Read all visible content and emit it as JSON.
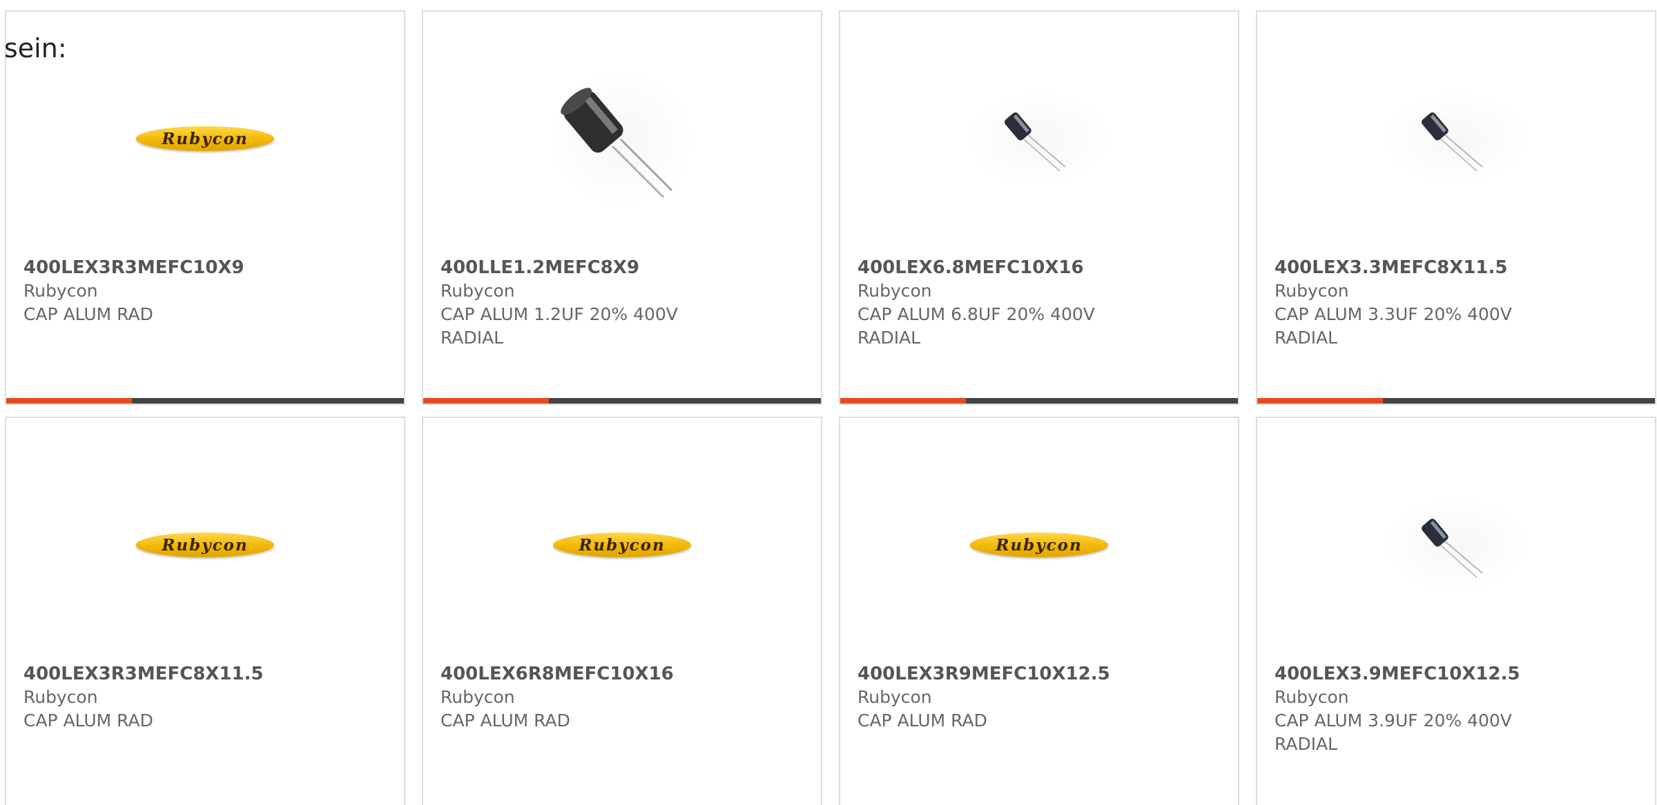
{
  "intro_text": "sein:",
  "colors": {
    "accent_bar": "#e84a1e",
    "bar": "#444444",
    "logo_yellow": "#f2b705"
  },
  "products": [
    {
      "part": "400LEX3R3MEFC10X9",
      "manufacturer": "Rubycon",
      "desc1": "CAP ALUM RAD",
      "desc2": "",
      "image": "rubycon-logo"
    },
    {
      "part": "400LLE1.2MEFC8X9",
      "manufacturer": "Rubycon",
      "desc1": "CAP ALUM 1.2UF 20% 400V",
      "desc2": "RADIAL",
      "image": "capacitor-photo-large"
    },
    {
      "part": "400LEX6.8MEFC10X16",
      "manufacturer": "Rubycon",
      "desc1": "CAP ALUM 6.8UF 20% 400V",
      "desc2": "RADIAL",
      "image": "capacitor-photo-small"
    },
    {
      "part": "400LEX3.3MEFC8X11.5",
      "manufacturer": "Rubycon",
      "desc1": "CAP ALUM 3.3UF 20% 400V",
      "desc2": "RADIAL",
      "image": "capacitor-photo-small"
    },
    {
      "part": "400LEX3R3MEFC8X11.5",
      "manufacturer": "Rubycon",
      "desc1": "CAP ALUM RAD",
      "desc2": "",
      "image": "rubycon-logo"
    },
    {
      "part": "400LEX6R8MEFC10X16",
      "manufacturer": "Rubycon",
      "desc1": "CAP ALUM RAD",
      "desc2": "",
      "image": "rubycon-logo"
    },
    {
      "part": "400LEX3R9MEFC10X12.5",
      "manufacturer": "Rubycon",
      "desc1": "CAP ALUM RAD",
      "desc2": "",
      "image": "rubycon-logo"
    },
    {
      "part": "400LEX3.9MEFC10X12.5",
      "manufacturer": "Rubycon",
      "desc1": "CAP ALUM 3.9UF 20% 400V",
      "desc2": "RADIAL",
      "image": "capacitor-photo-small"
    }
  ],
  "logo_text": "Rubycon"
}
